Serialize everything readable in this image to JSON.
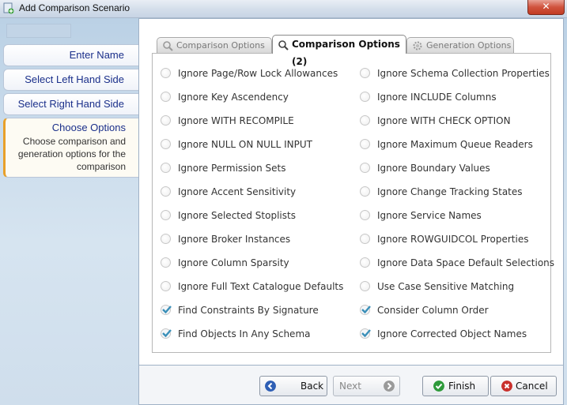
{
  "window": {
    "title": "Add Comparison Scenario",
    "close_label": "✕"
  },
  "nav": {
    "items": [
      {
        "label": "Enter Name"
      },
      {
        "label": "Select Left Hand Side"
      },
      {
        "label": "Select Right Hand Side"
      }
    ],
    "active": {
      "label": "Choose Options",
      "description_lines": [
        "Choose comparison and",
        "generation options for the",
        "comparison"
      ]
    }
  },
  "tabs": [
    {
      "label": "Comparison Options",
      "icon": "magnifier-icon",
      "active": false
    },
    {
      "label": "Comparison Options (2)",
      "icon": "magnifier-icon",
      "active": true
    },
    {
      "label": "Generation Options",
      "icon": "gear-icon",
      "active": false
    }
  ],
  "options": {
    "left": [
      {
        "label": "Ignore Page/Row Lock Allowances",
        "checked": false
      },
      {
        "label": "Ignore Key Ascendency",
        "checked": false
      },
      {
        "label": "Ignore WITH RECOMPILE",
        "checked": false
      },
      {
        "label": "Ignore NULL ON NULL INPUT",
        "checked": false
      },
      {
        "label": "Ignore Permission Sets",
        "checked": false
      },
      {
        "label": "Ignore Accent Sensitivity",
        "checked": false
      },
      {
        "label": "Ignore Selected Stoplists",
        "checked": false
      },
      {
        "label": "Ignore Broker Instances",
        "checked": false
      },
      {
        "label": "Ignore Column Sparsity",
        "checked": false
      },
      {
        "label": "Ignore Full Text Catalogue Defaults",
        "checked": false
      },
      {
        "label": "Find Constraints By Signature",
        "checked": true
      },
      {
        "label": "Find Objects In Any Schema",
        "checked": true
      }
    ],
    "right": [
      {
        "label": "Ignore Schema Collection Properties",
        "checked": false
      },
      {
        "label": "Ignore INCLUDE Columns",
        "checked": false
      },
      {
        "label": "Ignore WITH CHECK OPTION",
        "checked": false
      },
      {
        "label": "Ignore Maximum Queue Readers",
        "checked": false
      },
      {
        "label": "Ignore Boundary Values",
        "checked": false
      },
      {
        "label": "Ignore Change Tracking States",
        "checked": false
      },
      {
        "label": "Ignore Service Names",
        "checked": false
      },
      {
        "label": "Ignore ROWGUIDCOL Properties",
        "checked": false
      },
      {
        "label": "Ignore Data Space Default Selections",
        "checked": false
      },
      {
        "label": "Use Case Sensitive Matching",
        "checked": false
      },
      {
        "label": "Consider Column Order",
        "checked": true
      },
      {
        "label": "Ignore Corrected Object Names",
        "checked": true
      }
    ]
  },
  "buttons": {
    "back": {
      "label": "Back",
      "icon": "back-arrow-icon",
      "enabled": true
    },
    "next": {
      "label": "Next",
      "icon": "next-arrow-icon",
      "enabled": false
    },
    "finish": {
      "label": "Finish",
      "icon": "checkmark-icon",
      "enabled": true
    },
    "cancel": {
      "label": "Cancel",
      "icon": "cancel-x-icon",
      "enabled": true
    }
  },
  "colors": {
    "nav_text": "#1a2f8a",
    "accent": "#e8a02a",
    "checkmark": "#3a8fb8"
  }
}
